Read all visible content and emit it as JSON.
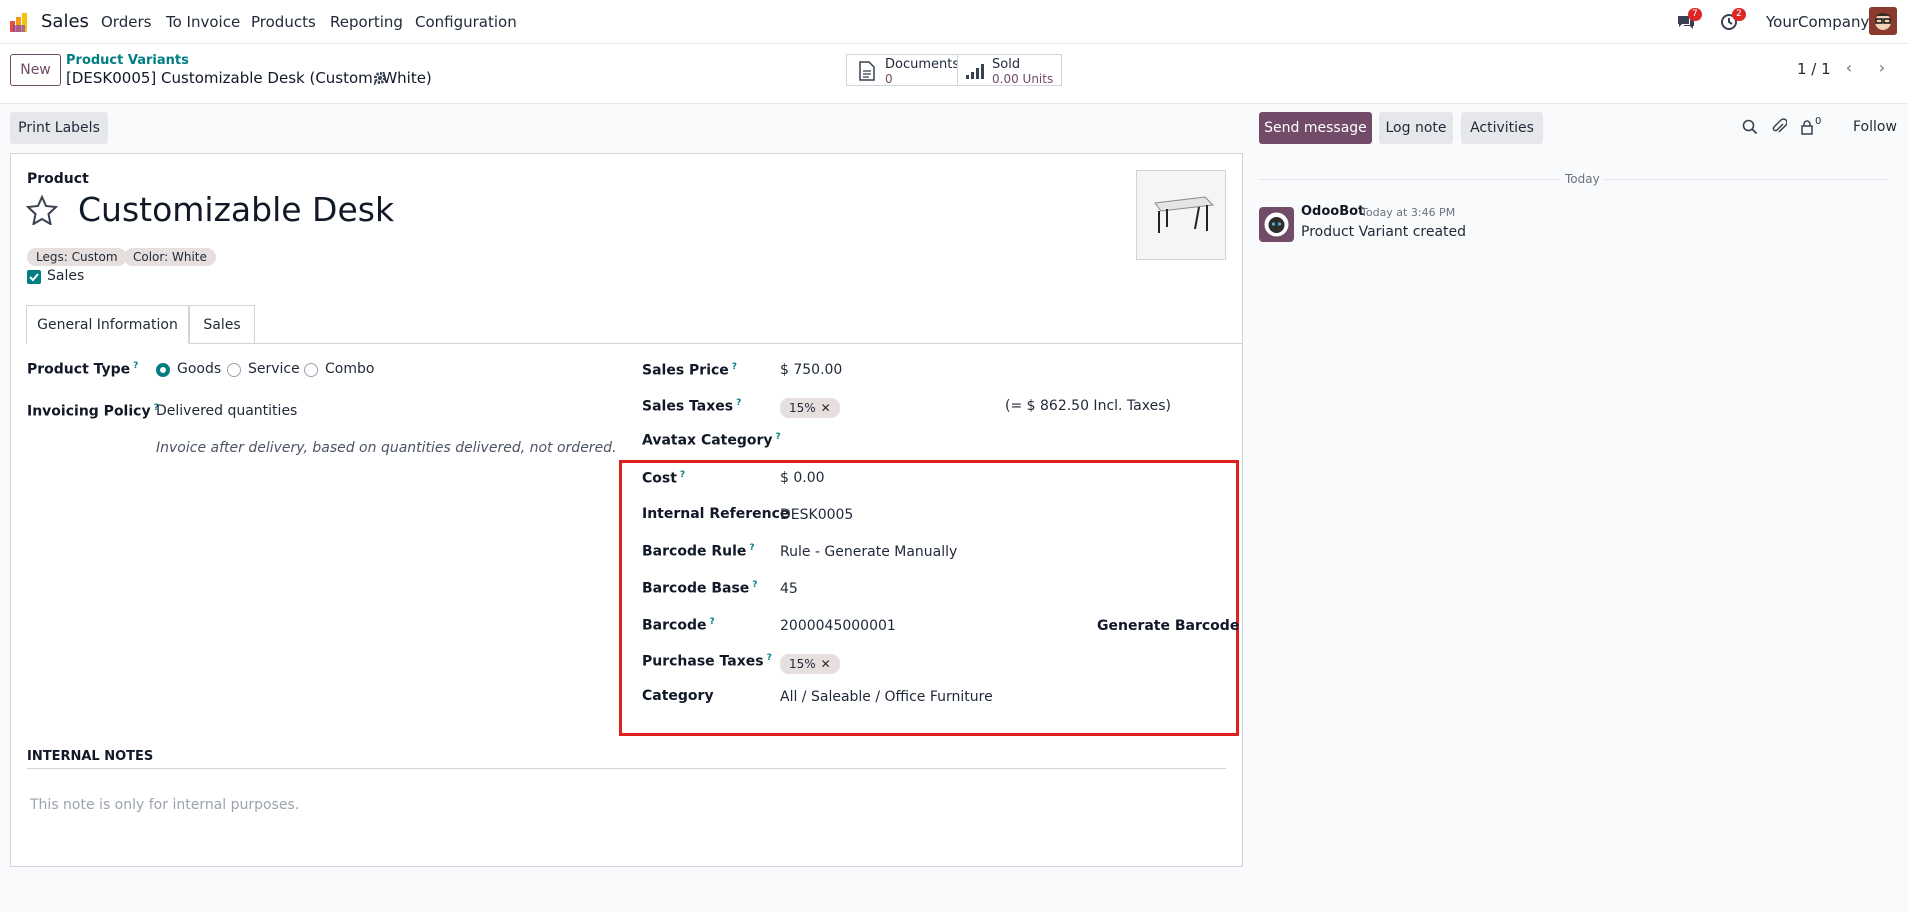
{
  "navbar": {
    "app_name": "Sales",
    "menu": [
      "Orders",
      "To Invoice",
      "Products",
      "Reporting",
      "Configuration"
    ],
    "messages_count": "7",
    "activities_count": "2",
    "company": "YourCompany"
  },
  "control": {
    "new_label": "New",
    "breadcrumb_parent": "Product Variants",
    "breadcrumb_current": "[DESK0005] Customizable Desk (Custom, White)",
    "documents_label": "Documents",
    "documents_value": "0",
    "sold_label": "Sold",
    "sold_value": "0.00 Units",
    "pager": "1 / 1"
  },
  "actions": {
    "print_labels": "Print Labels",
    "send_message": "Send message",
    "log_note": "Log note",
    "activities": "Activities",
    "followers_count": "0",
    "follow": "Follow"
  },
  "form": {
    "product_label": "Product",
    "product_name": "Customizable Desk",
    "attributes": [
      "Legs: Custom",
      "Color: White"
    ],
    "sales_checkbox_label": "Sales",
    "tabs": [
      "General Information",
      "Sales"
    ],
    "product_type_label": "Product Type",
    "product_type_options": [
      "Goods",
      "Service",
      "Combo"
    ],
    "product_type_selected": "Goods",
    "invoicing_policy_label": "Invoicing Policy",
    "invoicing_policy_value": "Delivered quantities",
    "invoicing_policy_hint": "Invoice after delivery, based on quantities delivered, not ordered.",
    "sales_price_label": "Sales Price",
    "sales_price_value": "$ 750.00",
    "sales_taxes_label": "Sales Taxes",
    "sales_taxes_tag": "15%",
    "sales_taxes_incl": "(= $ 862.50 Incl. Taxes)",
    "avatax_label": "Avatax Category",
    "cost_label": "Cost",
    "cost_value": "$ 0.00",
    "internal_ref_label": "Internal Reference",
    "internal_ref_value": "DESK0005",
    "barcode_rule_label": "Barcode Rule",
    "barcode_rule_value": "Rule - Generate Manually",
    "barcode_base_label": "Barcode Base",
    "barcode_base_value": "45",
    "barcode_label": "Barcode",
    "barcode_value": "2000045000001",
    "generate_barcode": "Generate Barcode",
    "purchase_taxes_label": "Purchase Taxes",
    "purchase_taxes_tag": "15%",
    "category_label": "Category",
    "category_value": "All / Saleable / Office Furniture",
    "internal_notes_title": "INTERNAL NOTES",
    "internal_notes_placeholder": "This note is only for internal purposes."
  },
  "chatter": {
    "date_separator": "Today",
    "author": "OdooBot",
    "time": "Today at 3:46 PM",
    "message": "Product Variant created"
  },
  "colors": {
    "brand": "#714b67",
    "accent": "#017e84",
    "highlight": "#e02020",
    "badge": "#dc2626"
  }
}
